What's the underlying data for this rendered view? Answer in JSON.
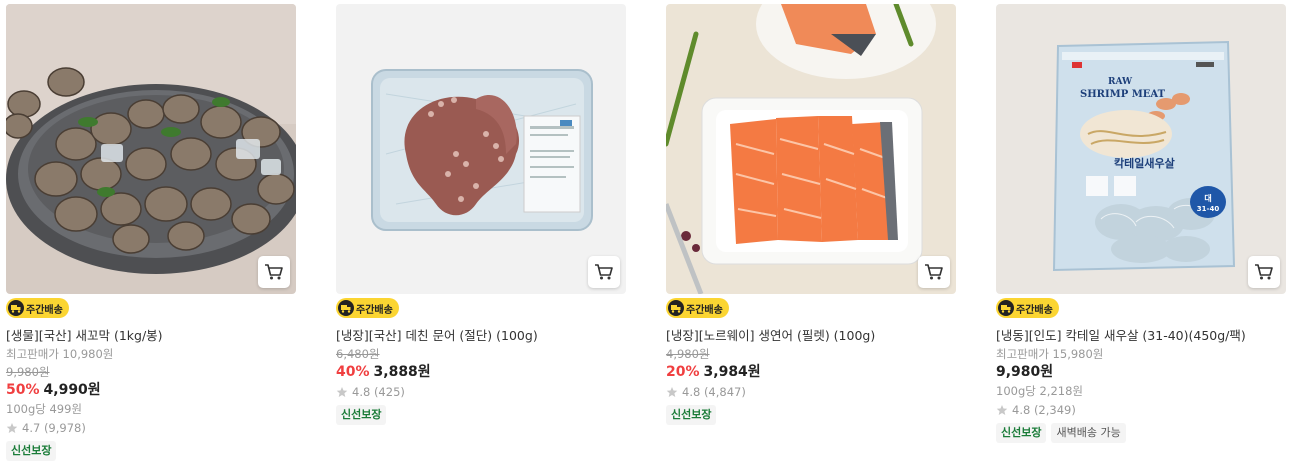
{
  "products": [
    {
      "badge": "주간배송",
      "title": "[생물][국산] 새꼬막 (1kg/봉)",
      "best_price": "최고판매가 10,980원",
      "original_price": "9,980원",
      "discount": "50%",
      "price": "4,990원",
      "unit_price": "100g당 499원",
      "rating": "4.7 (9,978)",
      "tags": [
        "신선보장"
      ]
    },
    {
      "badge": "주간배송",
      "title": "[냉장][국산] 데친 문어 (절단) (100g)",
      "original_price": "6,480원",
      "discount": "40%",
      "price": "3,888원",
      "rating": "4.8 (425)",
      "tags": [
        "신선보장"
      ]
    },
    {
      "badge": "주간배송",
      "title": "[냉장][노르웨이] 생연어 (필렛) (100g)",
      "original_price": "4,980원",
      "discount": "20%",
      "price": "3,984원",
      "rating": "4.8 (4,847)",
      "tags": [
        "신선보장"
      ]
    },
    {
      "badge": "주간배송",
      "title": "[냉동][인도] 칵테일 새우살 (31-40)(450g/팩)",
      "best_price": "최고판매가 15,980원",
      "price": "9,980원",
      "unit_price": "100g당 2,218원",
      "rating": "4.8 (2,349)",
      "tags": [
        "신선보장",
        "새벽배송 가능"
      ]
    }
  ],
  "package_text": {
    "raw": "RAW",
    "shrimp_meat": "SHRIMP MEAT",
    "korean": "칵테일새우살",
    "size_label": "대",
    "size": "31-40"
  },
  "icons": {
    "cart": "cart-icon",
    "star": "star-icon",
    "truck": "truck-icon"
  },
  "colors": {
    "accent_red": "#f03f40",
    "badge_yellow": "#fbd532",
    "tag_green": "#1a7c38"
  }
}
